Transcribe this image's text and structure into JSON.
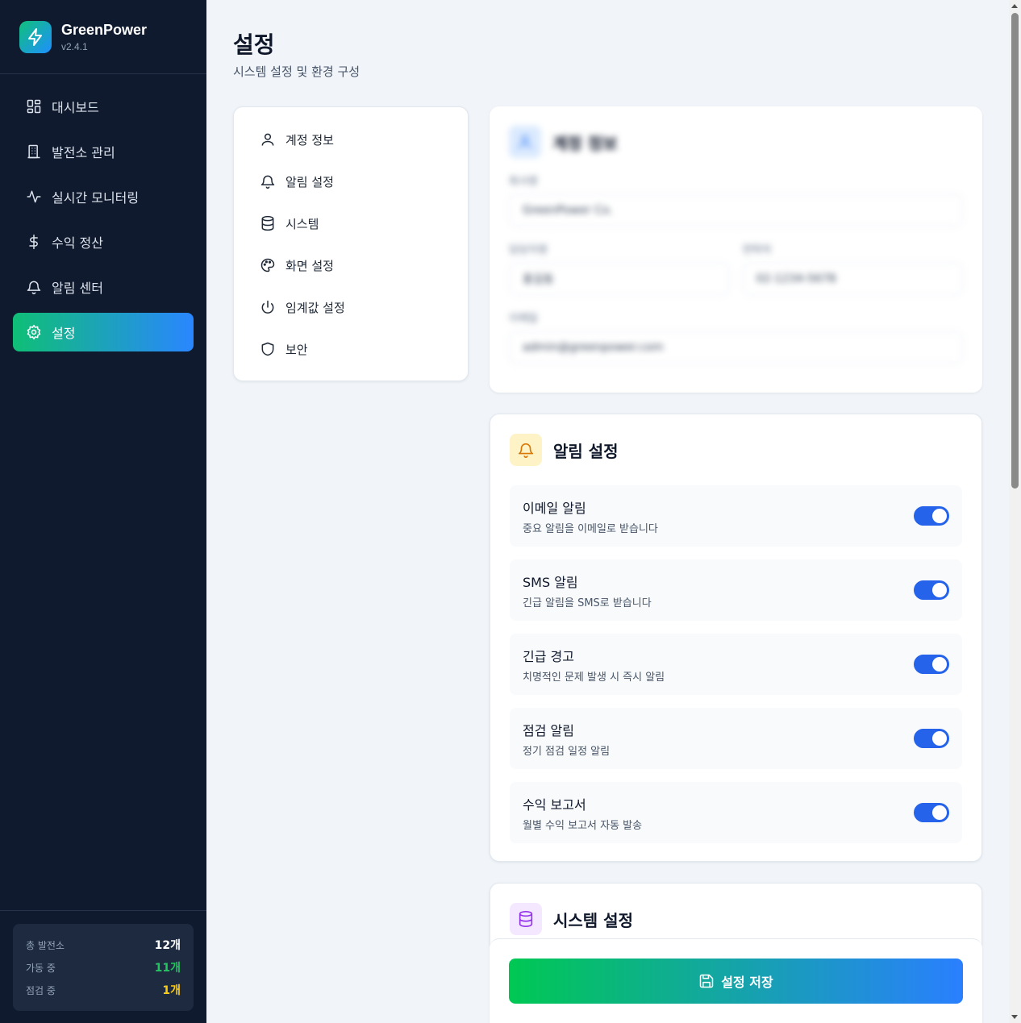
{
  "brand": {
    "name": "GreenPower",
    "version": "v2.4.1"
  },
  "sidebar": {
    "items": [
      {
        "label": "대시보드",
        "icon": "dashboard-icon"
      },
      {
        "label": "발전소 관리",
        "icon": "building-icon"
      },
      {
        "label": "실시간 모니터링",
        "icon": "activity-icon"
      },
      {
        "label": "수익 정산",
        "icon": "dollar-icon"
      },
      {
        "label": "알림 센터",
        "icon": "bell-icon"
      },
      {
        "label": "설정",
        "icon": "gear-icon",
        "active": true
      }
    ],
    "stats": [
      {
        "label": "총 발전소",
        "value": "12개",
        "color": "#ffffff"
      },
      {
        "label": "가동 중",
        "value": "11개",
        "color": "#22c55e"
      },
      {
        "label": "점검 중",
        "value": "1개",
        "color": "#facc15"
      }
    ]
  },
  "header": {
    "title": "설정",
    "subtitle": "시스템 설정 및 환경 구성"
  },
  "settings_nav": [
    {
      "label": "계정 정보",
      "icon": "user-icon"
    },
    {
      "label": "알림 설정",
      "icon": "bell-icon"
    },
    {
      "label": "시스템",
      "icon": "database-icon"
    },
    {
      "label": "화면 설정",
      "icon": "palette-icon"
    },
    {
      "label": "임계값 설정",
      "icon": "power-icon"
    },
    {
      "label": "보안",
      "icon": "shield-icon"
    }
  ],
  "account": {
    "title": "계정 정보",
    "company_label": "회사명",
    "company_value": "GreenPower Co.",
    "manager_label": "담당자명",
    "manager_value": "홍길동",
    "phone_label": "연락처",
    "phone_value": "02-1234-5678",
    "email_label": "이메일",
    "email_value": "admin@greenpower.com"
  },
  "notifications": {
    "title": "알림 설정",
    "items": [
      {
        "title": "이메일 알림",
        "desc": "중요 알림을 이메일로 받습니다",
        "on": true
      },
      {
        "title": "SMS 알림",
        "desc": "긴급 알림을 SMS로 받습니다",
        "on": true
      },
      {
        "title": "긴급 경고",
        "desc": "치명적인 문제 발생 시 즉시 알림",
        "on": true
      },
      {
        "title": "점검 알림",
        "desc": "정기 점검 일정 알림",
        "on": true
      },
      {
        "title": "수익 보고서",
        "desc": "월별 수익 보고서 자동 발송",
        "on": true
      }
    ]
  },
  "system": {
    "title": "시스템 설정"
  },
  "save": {
    "label": "설정 저장"
  },
  "colors": {
    "sidebar_bg": "#0f1a2e",
    "accent_green": "#00c853",
    "accent_blue": "#2a7fff",
    "toggle_on": "#2563eb"
  }
}
